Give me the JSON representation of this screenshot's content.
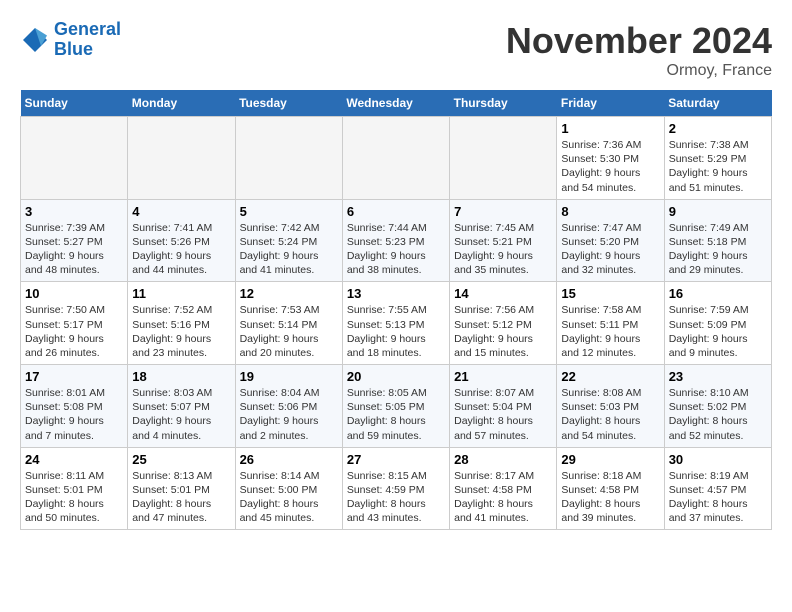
{
  "header": {
    "logo_line1": "General",
    "logo_line2": "Blue",
    "month_title": "November 2024",
    "location": "Ormoy, France"
  },
  "weekdays": [
    "Sunday",
    "Monday",
    "Tuesday",
    "Wednesday",
    "Thursday",
    "Friday",
    "Saturday"
  ],
  "weeks": [
    [
      {
        "day": "",
        "info": ""
      },
      {
        "day": "",
        "info": ""
      },
      {
        "day": "",
        "info": ""
      },
      {
        "day": "",
        "info": ""
      },
      {
        "day": "",
        "info": ""
      },
      {
        "day": "1",
        "info": "Sunrise: 7:36 AM\nSunset: 5:30 PM\nDaylight: 9 hours and 54 minutes."
      },
      {
        "day": "2",
        "info": "Sunrise: 7:38 AM\nSunset: 5:29 PM\nDaylight: 9 hours and 51 minutes."
      }
    ],
    [
      {
        "day": "3",
        "info": "Sunrise: 7:39 AM\nSunset: 5:27 PM\nDaylight: 9 hours and 48 minutes."
      },
      {
        "day": "4",
        "info": "Sunrise: 7:41 AM\nSunset: 5:26 PM\nDaylight: 9 hours and 44 minutes."
      },
      {
        "day": "5",
        "info": "Sunrise: 7:42 AM\nSunset: 5:24 PM\nDaylight: 9 hours and 41 minutes."
      },
      {
        "day": "6",
        "info": "Sunrise: 7:44 AM\nSunset: 5:23 PM\nDaylight: 9 hours and 38 minutes."
      },
      {
        "day": "7",
        "info": "Sunrise: 7:45 AM\nSunset: 5:21 PM\nDaylight: 9 hours and 35 minutes."
      },
      {
        "day": "8",
        "info": "Sunrise: 7:47 AM\nSunset: 5:20 PM\nDaylight: 9 hours and 32 minutes."
      },
      {
        "day": "9",
        "info": "Sunrise: 7:49 AM\nSunset: 5:18 PM\nDaylight: 9 hours and 29 minutes."
      }
    ],
    [
      {
        "day": "10",
        "info": "Sunrise: 7:50 AM\nSunset: 5:17 PM\nDaylight: 9 hours and 26 minutes."
      },
      {
        "day": "11",
        "info": "Sunrise: 7:52 AM\nSunset: 5:16 PM\nDaylight: 9 hours and 23 minutes."
      },
      {
        "day": "12",
        "info": "Sunrise: 7:53 AM\nSunset: 5:14 PM\nDaylight: 9 hours and 20 minutes."
      },
      {
        "day": "13",
        "info": "Sunrise: 7:55 AM\nSunset: 5:13 PM\nDaylight: 9 hours and 18 minutes."
      },
      {
        "day": "14",
        "info": "Sunrise: 7:56 AM\nSunset: 5:12 PM\nDaylight: 9 hours and 15 minutes."
      },
      {
        "day": "15",
        "info": "Sunrise: 7:58 AM\nSunset: 5:11 PM\nDaylight: 9 hours and 12 minutes."
      },
      {
        "day": "16",
        "info": "Sunrise: 7:59 AM\nSunset: 5:09 PM\nDaylight: 9 hours and 9 minutes."
      }
    ],
    [
      {
        "day": "17",
        "info": "Sunrise: 8:01 AM\nSunset: 5:08 PM\nDaylight: 9 hours and 7 minutes."
      },
      {
        "day": "18",
        "info": "Sunrise: 8:03 AM\nSunset: 5:07 PM\nDaylight: 9 hours and 4 minutes."
      },
      {
        "day": "19",
        "info": "Sunrise: 8:04 AM\nSunset: 5:06 PM\nDaylight: 9 hours and 2 minutes."
      },
      {
        "day": "20",
        "info": "Sunrise: 8:05 AM\nSunset: 5:05 PM\nDaylight: 8 hours and 59 minutes."
      },
      {
        "day": "21",
        "info": "Sunrise: 8:07 AM\nSunset: 5:04 PM\nDaylight: 8 hours and 57 minutes."
      },
      {
        "day": "22",
        "info": "Sunrise: 8:08 AM\nSunset: 5:03 PM\nDaylight: 8 hours and 54 minutes."
      },
      {
        "day": "23",
        "info": "Sunrise: 8:10 AM\nSunset: 5:02 PM\nDaylight: 8 hours and 52 minutes."
      }
    ],
    [
      {
        "day": "24",
        "info": "Sunrise: 8:11 AM\nSunset: 5:01 PM\nDaylight: 8 hours and 50 minutes."
      },
      {
        "day": "25",
        "info": "Sunrise: 8:13 AM\nSunset: 5:01 PM\nDaylight: 8 hours and 47 minutes."
      },
      {
        "day": "26",
        "info": "Sunrise: 8:14 AM\nSunset: 5:00 PM\nDaylight: 8 hours and 45 minutes."
      },
      {
        "day": "27",
        "info": "Sunrise: 8:15 AM\nSunset: 4:59 PM\nDaylight: 8 hours and 43 minutes."
      },
      {
        "day": "28",
        "info": "Sunrise: 8:17 AM\nSunset: 4:58 PM\nDaylight: 8 hours and 41 minutes."
      },
      {
        "day": "29",
        "info": "Sunrise: 8:18 AM\nSunset: 4:58 PM\nDaylight: 8 hours and 39 minutes."
      },
      {
        "day": "30",
        "info": "Sunrise: 8:19 AM\nSunset: 4:57 PM\nDaylight: 8 hours and 37 minutes."
      }
    ]
  ]
}
